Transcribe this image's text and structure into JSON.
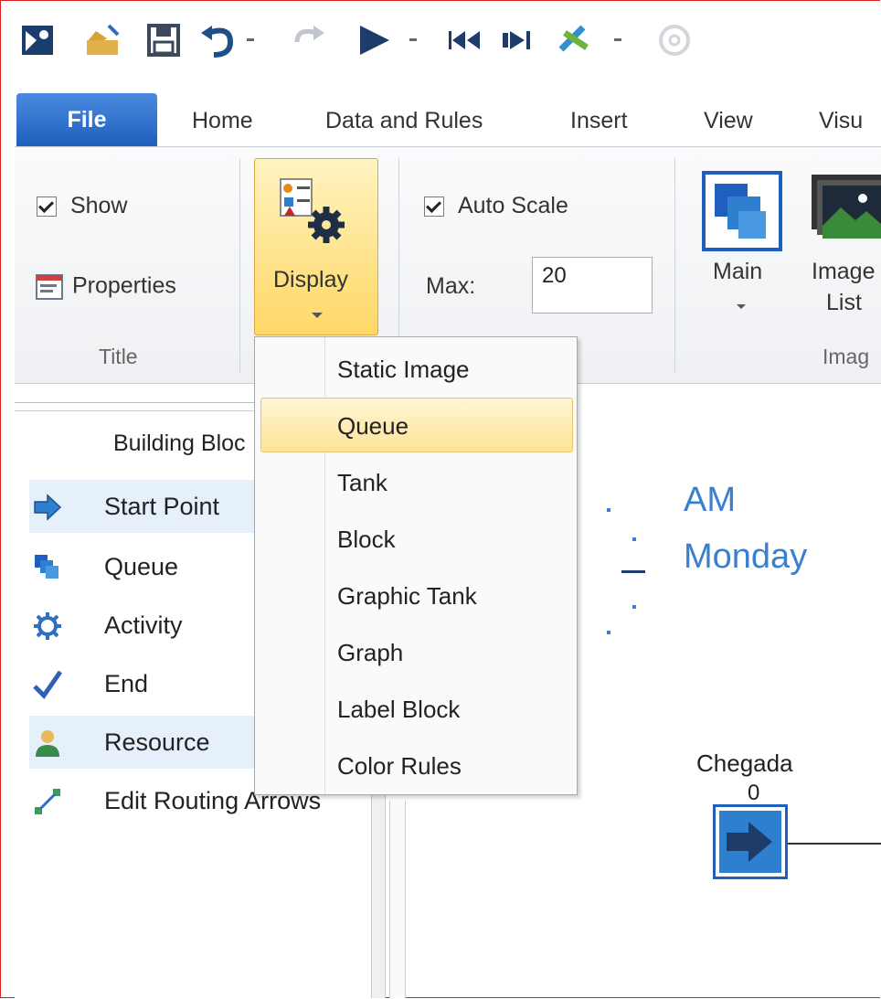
{
  "toolbar": {
    "icons": [
      "app-logo-icon",
      "open-icon",
      "save-icon",
      "undo-icon",
      "redo-icon",
      "run-icon",
      "reset-icon",
      "step-icon",
      "fast-forward-icon",
      "help-icon"
    ]
  },
  "tabs": [
    {
      "label": "File"
    },
    {
      "label": "Home"
    },
    {
      "label": "Data and Rules"
    },
    {
      "label": "Insert"
    },
    {
      "label": "View"
    },
    {
      "label": "Visu"
    }
  ],
  "ribbon": {
    "title_group": {
      "show_label": "Show",
      "show_checked": true,
      "properties_label": "Properties",
      "group_label": "Title"
    },
    "display_label": "Display",
    "scale_group": {
      "auto_scale_label": "Auto Scale",
      "auto_scale_checked": true,
      "max_label": "Max:",
      "max_value": "20"
    },
    "image_group": {
      "main_label": "Main",
      "image_list_label_1": "Image",
      "image_list_label_2": "List",
      "group_label": "Imag"
    }
  },
  "display_menu": {
    "items": [
      {
        "label": "Static Image"
      },
      {
        "label": "Queue"
      },
      {
        "label": "Tank"
      },
      {
        "label": "Block"
      },
      {
        "label": "Graphic Tank"
      },
      {
        "label": "Graph"
      },
      {
        "label": "Label Block"
      },
      {
        "label": "Color Rules"
      }
    ],
    "highlighted": "Queue"
  },
  "building_blocks": {
    "title": "Building Bloc",
    "items": [
      {
        "label": "Start Point",
        "icon": "arrow-right-icon"
      },
      {
        "label": "Queue",
        "icon": "queue-icon"
      },
      {
        "label": "Activity",
        "icon": "gear-icon"
      },
      {
        "label": "End",
        "icon": "checkmark-icon"
      },
      {
        "label": "Resource",
        "icon": "person-icon"
      },
      {
        "label": "Edit Routing Arrows",
        "icon": "routing-arrow-icon"
      }
    ]
  },
  "canvas": {
    "clock_am": "AM",
    "clock_day": "Monday",
    "node_label": "Chegada",
    "node_count": "0"
  },
  "colors": {
    "accent": "#1f5fbd",
    "highlight": "#fde399",
    "canvas_text": "#3a7fd0"
  }
}
